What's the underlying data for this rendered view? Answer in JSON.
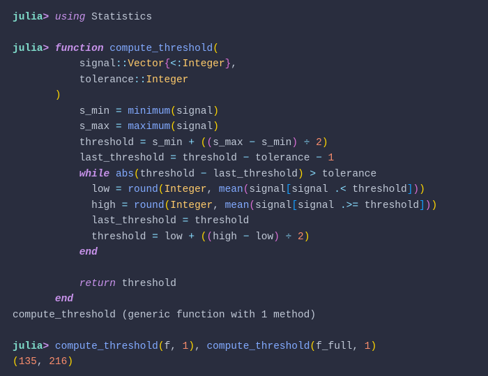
{
  "prompt": {
    "julia": "julia",
    "gt": ">"
  },
  "line1": {
    "using_kw": "using",
    "sp": " ",
    "pkg": "Statistics"
  },
  "line3": {
    "func_kw": "function",
    "sp": " ",
    "name": "compute_threshold",
    "open": "("
  },
  "line4": {
    "param": "signal",
    "dcolon": "::",
    "vec": "Vector",
    "ob": "{",
    "sub": "<:",
    "int": "Integer",
    "cb": "}",
    "comma": ","
  },
  "line5": {
    "param": "tolerance",
    "dcolon": "::",
    "int": "Integer"
  },
  "line6": {
    "close": ")"
  },
  "line7": {
    "lhs": "s_min",
    "sp1": " ",
    "eq": "=",
    "sp2": " ",
    "fn": "minimum",
    "open": "(",
    "arg": "signal",
    "close": ")"
  },
  "line8": {
    "lhs": "s_max",
    "sp1": " ",
    "eq": "=",
    "sp2": " ",
    "fn": "maximum",
    "open": "(",
    "arg": "signal",
    "close": ")"
  },
  "line9": {
    "lhs": "threshold",
    "eq": " = ",
    "a": "s_min",
    "plus": " + ",
    "op1": "(",
    "op2": "(",
    "b": "s_max",
    "minus": " − ",
    "c": "s_min",
    "cp2": ")",
    "div": " ÷ ",
    "two": "2",
    "cp1": ")"
  },
  "line10": {
    "lhs": "last_threshold",
    "eq": " = ",
    "a": "threshold",
    "m1": " − ",
    "b": "tolerance",
    "m2": " − ",
    "one": "1"
  },
  "line11": {
    "while_kw": "while",
    "sp": " ",
    "abs": "abs",
    "open": "(",
    "a": "threshold",
    "minus": " − ",
    "b": "last_threshold",
    "close": ")",
    "gt": " > ",
    "c": "tolerance"
  },
  "line12": {
    "lhs": "low",
    "eq": " = ",
    "round": "round",
    "o1": "(",
    "int": "Integer",
    "comma": ", ",
    "mean": "mean",
    "o2": "(",
    "sig": "signal",
    "o3": "[",
    "sig2": "signal",
    "dotlt": " .< ",
    "thr": "threshold",
    "c3": "]",
    "c2": ")",
    "c1": ")"
  },
  "line13": {
    "lhs": "high",
    "eq": " = ",
    "round": "round",
    "o1": "(",
    "int": "Integer",
    "comma": ", ",
    "mean": "mean",
    "o2": "(",
    "sig": "signal",
    "o3": "[",
    "sig2": "signal",
    "dotge": " .>= ",
    "thr": "threshold",
    "c3": "]",
    "c2": ")",
    "c1": ")"
  },
  "line14": {
    "lhs": "last_threshold",
    "eq": " = ",
    "rhs": "threshold"
  },
  "line15": {
    "lhs": "threshold",
    "eq": " = ",
    "a": "low",
    "plus": " + ",
    "o1": "(",
    "o2": "(",
    "b": "high",
    "minus": " − ",
    "c": "low",
    "c2": ")",
    "div": " ÷ ",
    "two": "2",
    "c1": ")"
  },
  "line16": {
    "end_kw": "end"
  },
  "line18": {
    "ret_kw": "return",
    "sp": " ",
    "val": "threshold"
  },
  "line19": {
    "end_kw": "end"
  },
  "line20": {
    "text": "compute_threshold (generic function with 1 method)"
  },
  "line22": {
    "fn": "compute_threshold",
    "o1": "(",
    "a1": "f",
    "c1": ", ",
    "n1": "1",
    "cl1": ")",
    "sep": ", ",
    "fn2": "compute_threshold",
    "o2": "(",
    "a2": "f_full",
    "c2": ", ",
    "n2": "1",
    "cl2": ")"
  },
  "line23": {
    "open": "(",
    "v1": "135",
    "comma": ", ",
    "v2": "216",
    "close": ")"
  }
}
